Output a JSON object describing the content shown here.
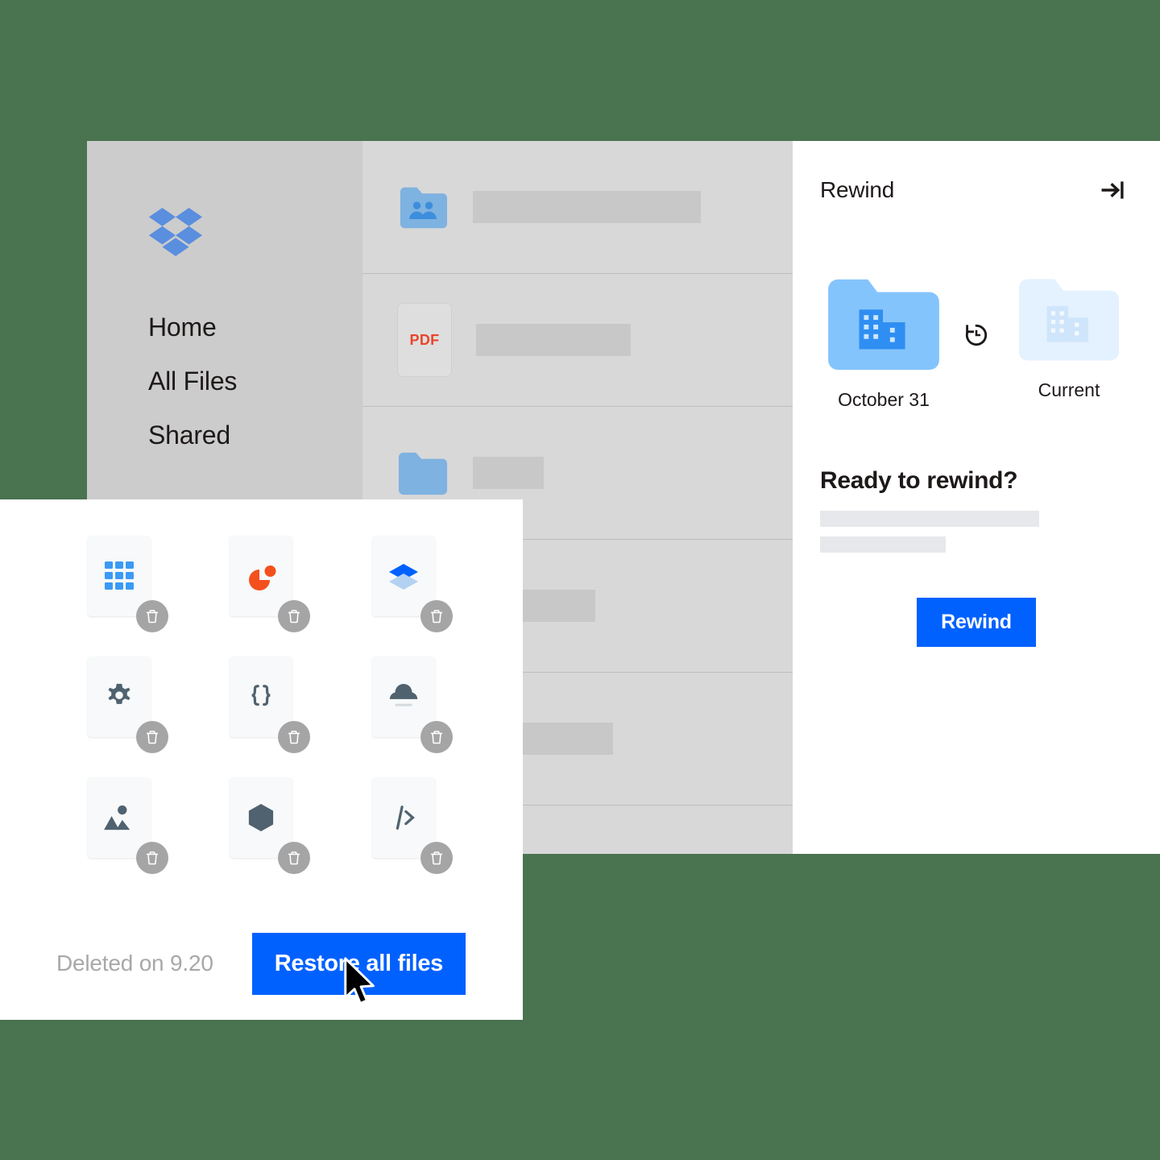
{
  "theme": {
    "background": "#4a7350",
    "accent_blue": "#0061fe",
    "sidebar_gray": "#cccccc",
    "content_gray": "#d8d8d8",
    "folder_blue": "#7eb2e0",
    "pdf_red": "#e8462a"
  },
  "sidebar": {
    "logo": "dropbox-logo",
    "items": [
      {
        "label": "Home"
      },
      {
        "label": "All Files"
      },
      {
        "label": "Shared"
      }
    ]
  },
  "file_list": {
    "rows": [
      {
        "icon": "shared-folder-icon",
        "name_bar_width": 283
      },
      {
        "icon": "pdf-file-icon",
        "name_bar_width": 192,
        "label": "PDF"
      },
      {
        "icon": "folder-icon",
        "name_bar_width": 88
      },
      {
        "icon": "hidden",
        "name_bar_width": 152
      },
      {
        "icon": "hidden",
        "name_bar_width": 174
      },
      {
        "icon": "hidden",
        "name_bar_width": 0
      }
    ]
  },
  "rewind_panel": {
    "title": "Rewind",
    "collapse_icon": "collapse-right-icon",
    "history_icon": "history-rewind-icon",
    "folders": [
      {
        "caption": "October 31",
        "state": "past"
      },
      {
        "caption": "Current",
        "state": "current"
      }
    ],
    "ready_heading": "Ready to rewind?",
    "rewind_button": "Rewind"
  },
  "deleted_panel": {
    "items": [
      {
        "icon": "grid-app-icon",
        "badge": "trash-icon"
      },
      {
        "icon": "pie-chart-icon",
        "badge": "trash-icon"
      },
      {
        "icon": "dropbox-paper-icon",
        "badge": "trash-icon"
      },
      {
        "icon": "gear-icon",
        "badge": "trash-icon"
      },
      {
        "icon": "code-braces-icon",
        "badge": "trash-icon"
      },
      {
        "icon": "cloud-upload-icon",
        "badge": "trash-icon"
      },
      {
        "icon": "image-icon",
        "badge": "trash-icon"
      },
      {
        "icon": "hexagon-icon",
        "badge": "trash-icon"
      },
      {
        "icon": "code-slash-icon",
        "badge": "trash-icon"
      }
    ],
    "deleted_on_label": "Deleted on 9.20",
    "restore_button": "Restore all files",
    "cursor": "mouse-pointer-cursor"
  }
}
